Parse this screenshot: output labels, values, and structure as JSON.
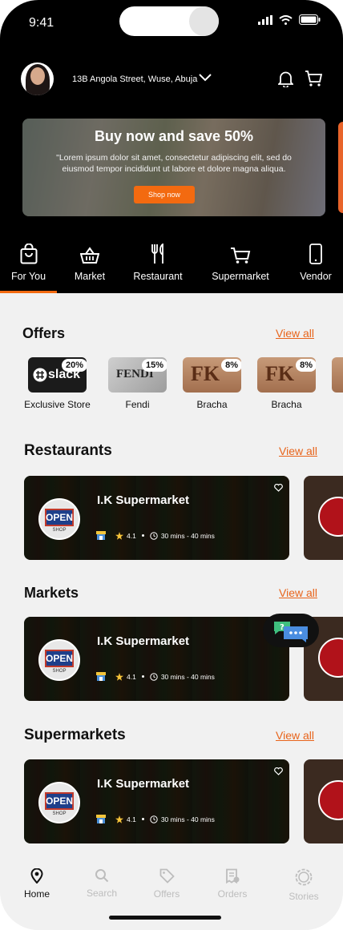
{
  "status_bar": {
    "time": "9:41"
  },
  "header": {
    "address": "13B Angola Street, Wuse, Abuja",
    "icons": [
      "chevron-down-icon",
      "bell-icon",
      "cart-icon"
    ]
  },
  "banner": {
    "title": "Buy now and save 50%",
    "body": "\"Lorem ipsum dolor sit amet, consectetur adipiscing elit, sed do eiusmod tempor incididunt ut labore et dolore magna aliqua.",
    "button": "Shop now"
  },
  "tabs": [
    {
      "label": "For You",
      "icon": "bag-icon",
      "active": true
    },
    {
      "label": "Market",
      "icon": "basket-icon"
    },
    {
      "label": "Restaurant",
      "icon": "fork-knife-icon"
    },
    {
      "label": "Supermarket",
      "icon": "cart-icon"
    },
    {
      "label": "Vendor",
      "icon": "phone-icon"
    }
  ],
  "offers": {
    "title": "Offers",
    "view_all": "View all",
    "items": [
      {
        "name": "Exclusive Store",
        "badge": "20%",
        "brand": "slack"
      },
      {
        "name": "Fendi",
        "badge": "15%",
        "brand": "FENDI"
      },
      {
        "name": "Bracha",
        "badge": "8%",
        "brand": "FK"
      },
      {
        "name": "Bracha",
        "badge": "8%",
        "brand": "FK"
      }
    ]
  },
  "restaurants": {
    "title": "Restaurants",
    "view_all": "View all",
    "card": {
      "name": "I.K Supermarket",
      "rating": "4.1",
      "time": "30 mins - 40 mins",
      "logo_text": "OPEN",
      "logo_sub": "SHOP"
    }
  },
  "markets": {
    "title": "Markets",
    "view_all": "View all",
    "card": {
      "name": "I.K Supermarket",
      "rating": "4.1",
      "time": "30 mins - 40 mins",
      "logo_text": "OPEN",
      "logo_sub": "SHOP"
    }
  },
  "supermarkets": {
    "title": "Supermarkets",
    "view_all": "View all",
    "card": {
      "name": "I.K Supermarket",
      "rating": "4.1",
      "time": "30 mins - 40 mins",
      "logo_text": "OPEN",
      "logo_sub": "SHOP"
    }
  },
  "chat_icon": {
    "symbol": "?"
  },
  "bottom_nav": [
    {
      "label": "Home",
      "icon": "home-pin-icon",
      "active": true
    },
    {
      "label": "Search",
      "icon": "search-icon"
    },
    {
      "label": "Offers",
      "icon": "tag-icon"
    },
    {
      "label": "Orders",
      "icon": "receipt-icon"
    },
    {
      "label": "Stories",
      "icon": "stories-icon"
    }
  ],
  "colors": {
    "accent": "#f36a10",
    "link": "#e8641b",
    "background": "#f1f1f1",
    "header": "#000000"
  }
}
